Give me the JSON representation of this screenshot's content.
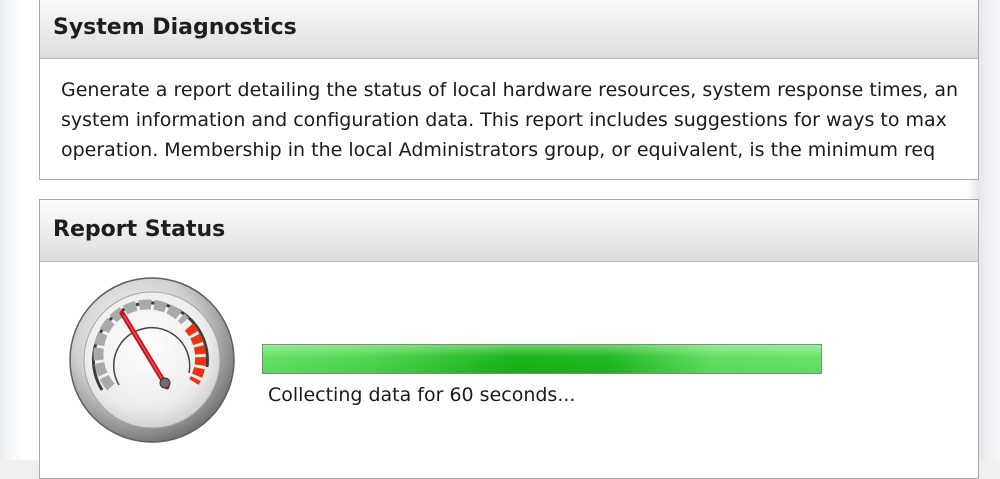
{
  "system_diagnostics": {
    "title": "System Diagnostics",
    "description_lines": [
      "Generate a report detailing the status of local hardware resources, system response times, an",
      "system information and configuration data. This report includes suggestions for ways to max",
      "operation. Membership in the local Administrators group, or equivalent, is the minimum req"
    ]
  },
  "report_status": {
    "title": "Report Status",
    "gauge_icon": "performance-gauge-icon",
    "progress_percent": 100,
    "progress_color": "#4ed64e",
    "status_text": "Collecting data for 60 seconds..."
  }
}
